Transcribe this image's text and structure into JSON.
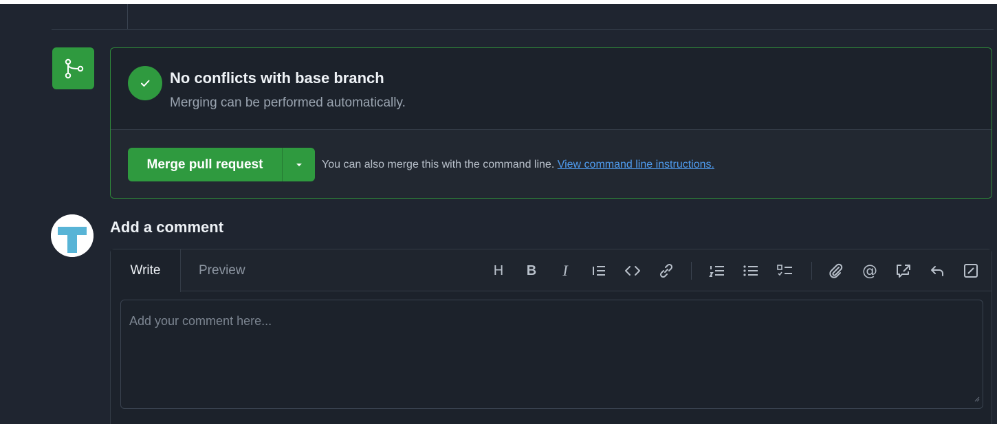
{
  "merge": {
    "status_title": "No conflicts with base branch",
    "status_subtitle": "Merging can be performed automatically.",
    "merge_button_label": "Merge pull request",
    "hint_text": "You can also merge this with the command line.",
    "hint_link": "View command line instructions."
  },
  "comment": {
    "heading": "Add a comment",
    "tabs": [
      "Write",
      "Preview"
    ],
    "placeholder": "Add your comment here...",
    "toolbar_icons": [
      "heading-icon",
      "bold-icon",
      "italic-icon",
      "quote-icon",
      "code-icon",
      "link-icon",
      "numbered-list-icon",
      "unordered-list-icon",
      "task-list-icon",
      "attach-icon",
      "mention-icon",
      "reference-icon",
      "undo-icon",
      "slash-commands-icon"
    ]
  },
  "colors": {
    "accent_green": "#2f9a3f",
    "link_blue": "#4f9cf0",
    "background": "#1f2530"
  }
}
